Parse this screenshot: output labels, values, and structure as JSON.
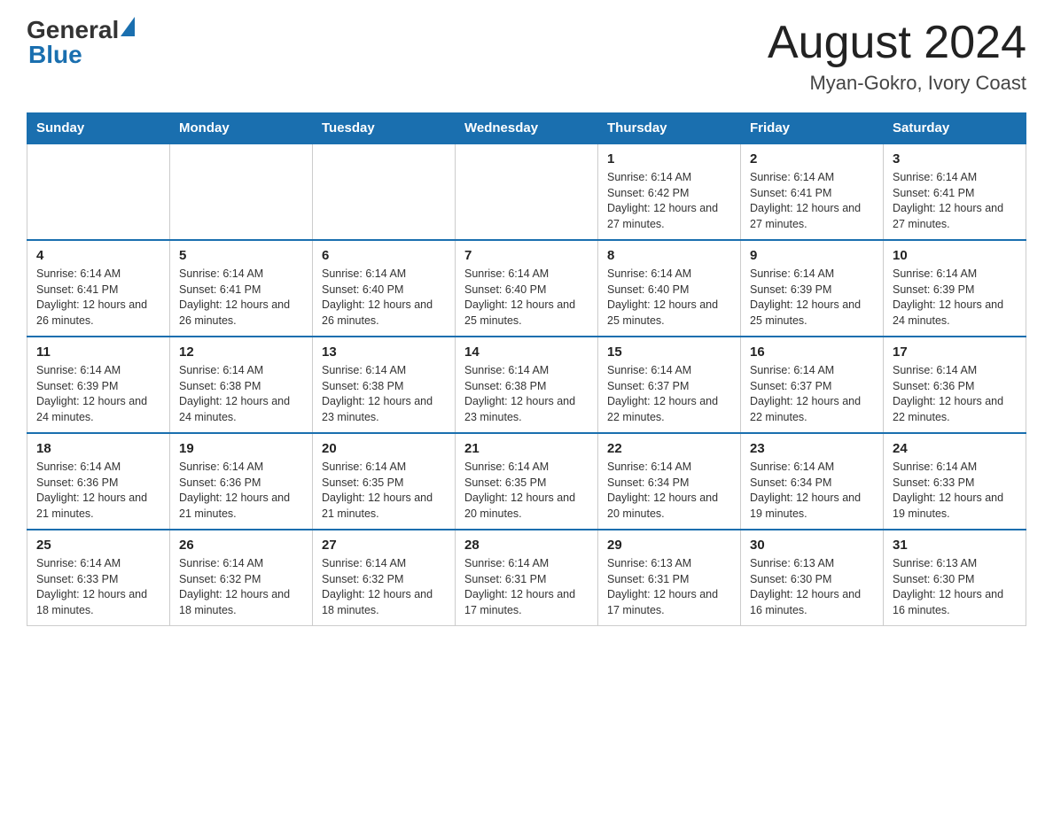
{
  "header": {
    "logo_general": "General",
    "logo_blue": "Blue",
    "month_title": "August 2024",
    "location": "Myan-Gokro, Ivory Coast"
  },
  "weekdays": [
    "Sunday",
    "Monday",
    "Tuesday",
    "Wednesday",
    "Thursday",
    "Friday",
    "Saturday"
  ],
  "weeks": [
    [
      {
        "day": "",
        "info": ""
      },
      {
        "day": "",
        "info": ""
      },
      {
        "day": "",
        "info": ""
      },
      {
        "day": "",
        "info": ""
      },
      {
        "day": "1",
        "info": "Sunrise: 6:14 AM\nSunset: 6:42 PM\nDaylight: 12 hours and 27 minutes."
      },
      {
        "day": "2",
        "info": "Sunrise: 6:14 AM\nSunset: 6:41 PM\nDaylight: 12 hours and 27 minutes."
      },
      {
        "day": "3",
        "info": "Sunrise: 6:14 AM\nSunset: 6:41 PM\nDaylight: 12 hours and 27 minutes."
      }
    ],
    [
      {
        "day": "4",
        "info": "Sunrise: 6:14 AM\nSunset: 6:41 PM\nDaylight: 12 hours and 26 minutes."
      },
      {
        "day": "5",
        "info": "Sunrise: 6:14 AM\nSunset: 6:41 PM\nDaylight: 12 hours and 26 minutes."
      },
      {
        "day": "6",
        "info": "Sunrise: 6:14 AM\nSunset: 6:40 PM\nDaylight: 12 hours and 26 minutes."
      },
      {
        "day": "7",
        "info": "Sunrise: 6:14 AM\nSunset: 6:40 PM\nDaylight: 12 hours and 25 minutes."
      },
      {
        "day": "8",
        "info": "Sunrise: 6:14 AM\nSunset: 6:40 PM\nDaylight: 12 hours and 25 minutes."
      },
      {
        "day": "9",
        "info": "Sunrise: 6:14 AM\nSunset: 6:39 PM\nDaylight: 12 hours and 25 minutes."
      },
      {
        "day": "10",
        "info": "Sunrise: 6:14 AM\nSunset: 6:39 PM\nDaylight: 12 hours and 24 minutes."
      }
    ],
    [
      {
        "day": "11",
        "info": "Sunrise: 6:14 AM\nSunset: 6:39 PM\nDaylight: 12 hours and 24 minutes."
      },
      {
        "day": "12",
        "info": "Sunrise: 6:14 AM\nSunset: 6:38 PM\nDaylight: 12 hours and 24 minutes."
      },
      {
        "day": "13",
        "info": "Sunrise: 6:14 AM\nSunset: 6:38 PM\nDaylight: 12 hours and 23 minutes."
      },
      {
        "day": "14",
        "info": "Sunrise: 6:14 AM\nSunset: 6:38 PM\nDaylight: 12 hours and 23 minutes."
      },
      {
        "day": "15",
        "info": "Sunrise: 6:14 AM\nSunset: 6:37 PM\nDaylight: 12 hours and 22 minutes."
      },
      {
        "day": "16",
        "info": "Sunrise: 6:14 AM\nSunset: 6:37 PM\nDaylight: 12 hours and 22 minutes."
      },
      {
        "day": "17",
        "info": "Sunrise: 6:14 AM\nSunset: 6:36 PM\nDaylight: 12 hours and 22 minutes."
      }
    ],
    [
      {
        "day": "18",
        "info": "Sunrise: 6:14 AM\nSunset: 6:36 PM\nDaylight: 12 hours and 21 minutes."
      },
      {
        "day": "19",
        "info": "Sunrise: 6:14 AM\nSunset: 6:36 PM\nDaylight: 12 hours and 21 minutes."
      },
      {
        "day": "20",
        "info": "Sunrise: 6:14 AM\nSunset: 6:35 PM\nDaylight: 12 hours and 21 minutes."
      },
      {
        "day": "21",
        "info": "Sunrise: 6:14 AM\nSunset: 6:35 PM\nDaylight: 12 hours and 20 minutes."
      },
      {
        "day": "22",
        "info": "Sunrise: 6:14 AM\nSunset: 6:34 PM\nDaylight: 12 hours and 20 minutes."
      },
      {
        "day": "23",
        "info": "Sunrise: 6:14 AM\nSunset: 6:34 PM\nDaylight: 12 hours and 19 minutes."
      },
      {
        "day": "24",
        "info": "Sunrise: 6:14 AM\nSunset: 6:33 PM\nDaylight: 12 hours and 19 minutes."
      }
    ],
    [
      {
        "day": "25",
        "info": "Sunrise: 6:14 AM\nSunset: 6:33 PM\nDaylight: 12 hours and 18 minutes."
      },
      {
        "day": "26",
        "info": "Sunrise: 6:14 AM\nSunset: 6:32 PM\nDaylight: 12 hours and 18 minutes."
      },
      {
        "day": "27",
        "info": "Sunrise: 6:14 AM\nSunset: 6:32 PM\nDaylight: 12 hours and 18 minutes."
      },
      {
        "day": "28",
        "info": "Sunrise: 6:14 AM\nSunset: 6:31 PM\nDaylight: 12 hours and 17 minutes."
      },
      {
        "day": "29",
        "info": "Sunrise: 6:13 AM\nSunset: 6:31 PM\nDaylight: 12 hours and 17 minutes."
      },
      {
        "day": "30",
        "info": "Sunrise: 6:13 AM\nSunset: 6:30 PM\nDaylight: 12 hours and 16 minutes."
      },
      {
        "day": "31",
        "info": "Sunrise: 6:13 AM\nSunset: 6:30 PM\nDaylight: 12 hours and 16 minutes."
      }
    ]
  ]
}
